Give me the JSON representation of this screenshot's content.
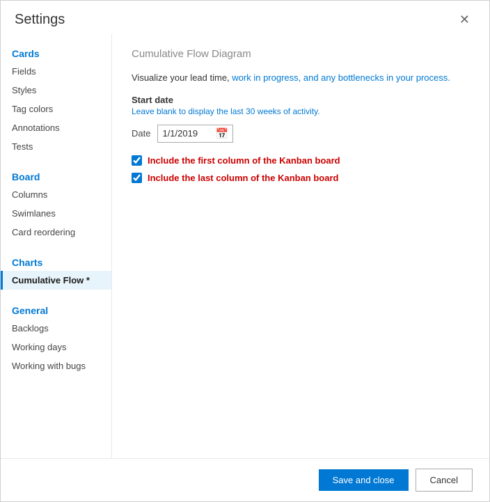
{
  "dialog": {
    "title": "Settings",
    "close_label": "✕"
  },
  "sidebar": {
    "cards_label": "Cards",
    "cards_items": [
      "Fields",
      "Styles",
      "Tag colors",
      "Annotations",
      "Tests"
    ],
    "board_label": "Board",
    "board_items": [
      "Columns",
      "Swimlanes",
      "Card reordering"
    ],
    "charts_label": "Charts",
    "charts_items": [
      "Cumulative Flow *"
    ],
    "general_label": "General",
    "general_items": [
      "Backlogs",
      "Working days",
      "Working with bugs"
    ]
  },
  "main": {
    "page_title": "Cumulative Flow Diagram",
    "description_plain": "Visualize your lead time, work in progress, and any bottlenecks in your process.",
    "start_date_label": "Start date",
    "start_date_hint": "Leave blank to display the last 30 weeks of activity.",
    "date_label": "Date",
    "date_value": "1/1/2019",
    "checkbox1_label": "Include the first column of the Kanban board",
    "checkbox2_label": "Include the last column of the Kanban board"
  },
  "footer": {
    "save_label": "Save and close",
    "cancel_label": "Cancel"
  }
}
